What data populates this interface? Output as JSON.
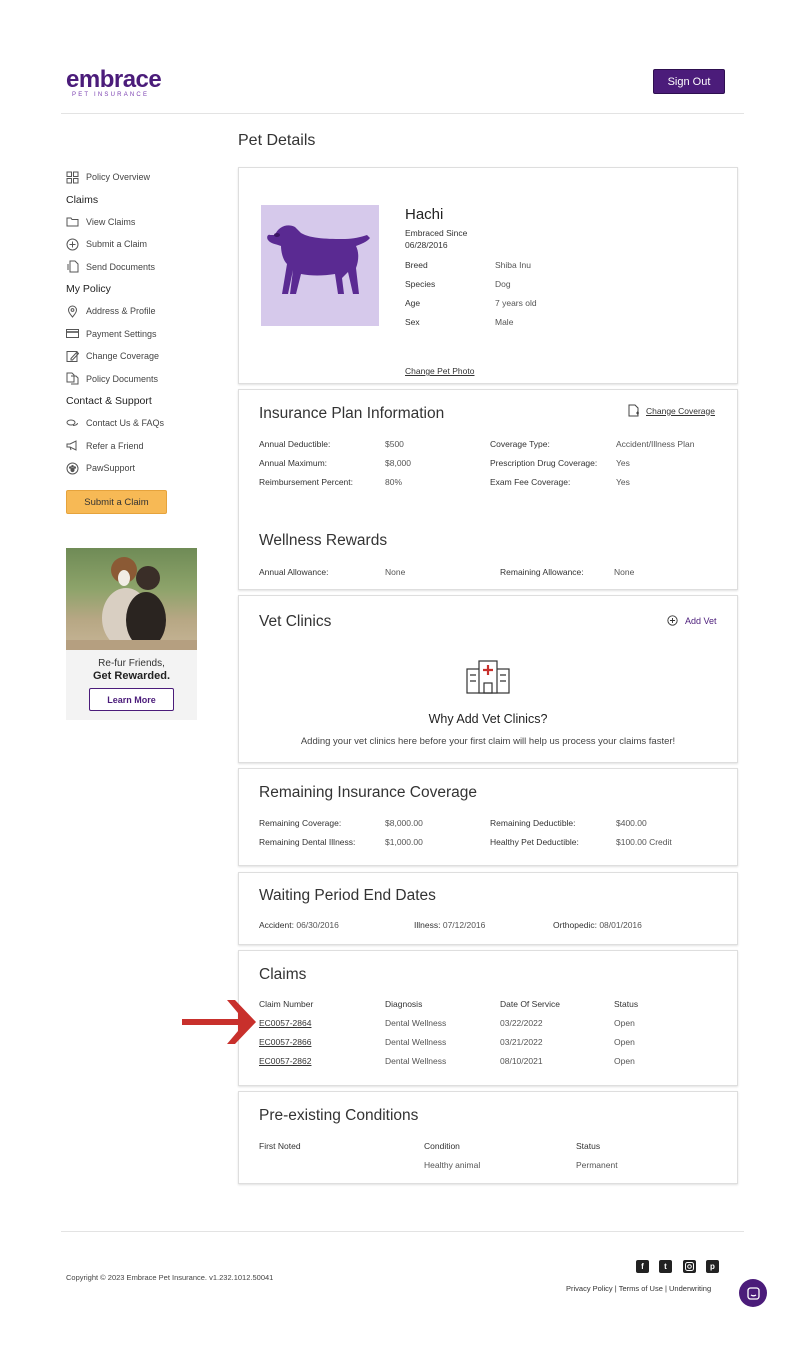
{
  "header": {
    "logo_word": "embrace",
    "logo_sub": "PET INSURANCE",
    "sign_out": "Sign Out"
  },
  "page_title": "Pet Details",
  "sidebar": {
    "items": [
      {
        "label": "Policy Overview",
        "icon": "grid-icon"
      },
      {
        "section": "Claims"
      },
      {
        "label": "View Claims",
        "icon": "folder-icon"
      },
      {
        "label": "Submit a Claim",
        "icon": "plus-circle-icon"
      },
      {
        "label": "Send Documents",
        "icon": "document-icon"
      },
      {
        "section": "My Policy"
      },
      {
        "label": "Address & Profile",
        "icon": "location-pin-icon"
      },
      {
        "label": "Payment Settings",
        "icon": "credit-card-icon"
      },
      {
        "label": "Change Coverage",
        "icon": "edit-icon"
      },
      {
        "label": "Policy Documents",
        "icon": "documents-icon"
      },
      {
        "section": "Contact & Support"
      },
      {
        "label": "Contact Us & FAQs",
        "icon": "chat-bubbles-icon"
      },
      {
        "label": "Refer a Friend",
        "icon": "megaphone-icon"
      },
      {
        "label": "PawSupport",
        "icon": "paw-icon"
      }
    ],
    "submit_claim": "Submit a Claim",
    "promo": {
      "line1": "Re-fur Friends,",
      "line2": "Get Rewarded.",
      "button": "Learn More"
    }
  },
  "pet": {
    "name": "Hachi",
    "embraced_since_label": "Embraced Since",
    "embraced_since": "06/28/2016",
    "fields": [
      {
        "label": "Breed",
        "value": "Shiba Inu"
      },
      {
        "label": "Species",
        "value": "Dog"
      },
      {
        "label": "Age",
        "value": "7 years old"
      },
      {
        "label": "Sex",
        "value": "Male"
      }
    ],
    "change_photo": "Change Pet Photo",
    "photo_bg": "#d6c9eb",
    "silhouette_color": "#5a2a92"
  },
  "plan": {
    "title": "Insurance Plan Information",
    "change_coverage": "Change Coverage",
    "left": [
      {
        "label": "Annual Deductible:",
        "value": "$500"
      },
      {
        "label": "Annual Maximum:",
        "value": "$8,000"
      },
      {
        "label": "Reimbursement Percent:",
        "value": "80%"
      }
    ],
    "right": [
      {
        "label": "Coverage Type:",
        "value": "Accident/Illness Plan"
      },
      {
        "label": "Prescription Drug Coverage:",
        "value": "Yes"
      },
      {
        "label": "Exam Fee Coverage:",
        "value": "Yes"
      }
    ],
    "wellness_title": "Wellness Rewards",
    "wellness": [
      {
        "label": "Annual Allowance:",
        "value": "None"
      },
      {
        "label": "Remaining Allowance:",
        "value": "None"
      }
    ]
  },
  "vet": {
    "title": "Vet Clinics",
    "add_vet": "Add Vet",
    "heading": "Why Add Vet Clinics?",
    "text": "Adding your vet clinics here before your first claim will help us process your claims faster!"
  },
  "remaining": {
    "title": "Remaining Insurance Coverage",
    "left": [
      {
        "label": "Remaining Coverage:",
        "value": "$8,000.00"
      },
      {
        "label": "Remaining Dental Illness:",
        "value": "$1,000.00"
      }
    ],
    "right": [
      {
        "label": "Remaining Deductible:",
        "value": "$400.00"
      },
      {
        "label": "Healthy Pet Deductible:",
        "value": "$100.00 Credit"
      }
    ]
  },
  "waiting": {
    "title": "Waiting Period End Dates",
    "items": [
      {
        "label": "Accident:",
        "value": "06/30/2016"
      },
      {
        "label": "Illness:",
        "value": "07/12/2016"
      },
      {
        "label": "Orthopedic:",
        "value": "08/01/2016"
      }
    ]
  },
  "claims": {
    "title": "Claims",
    "headers": [
      "Claim Number",
      "Diagnosis",
      "Date Of Service",
      "Status"
    ],
    "rows": [
      [
        "EC0057-2864",
        "Dental Wellness",
        "03/22/2022",
        "Open"
      ],
      [
        "EC0057-2866",
        "Dental Wellness",
        "03/21/2022",
        "Open"
      ],
      [
        "EC0057-2862",
        "Dental Wellness",
        "08/10/2021",
        "Open"
      ]
    ],
    "arrow_color": "#c8302c"
  },
  "preexisting": {
    "title": "Pre-existing Conditions",
    "headers": [
      "First Noted",
      "Condition",
      "Status"
    ],
    "rows": [
      [
        "",
        "Healthy animal",
        "Permanent"
      ]
    ]
  },
  "footer": {
    "copyright": "Copyright © 2023   Embrace Pet Insurance. v1.232.1012.50041",
    "links": [
      "Privacy Policy",
      "Terms of Use",
      "Underwriting"
    ],
    "social": [
      "facebook-icon",
      "twitter-icon",
      "instagram-icon",
      "pinterest-icon"
    ]
  },
  "colors": {
    "brand": "#4b1c7a",
    "accent": "#f7b955"
  }
}
